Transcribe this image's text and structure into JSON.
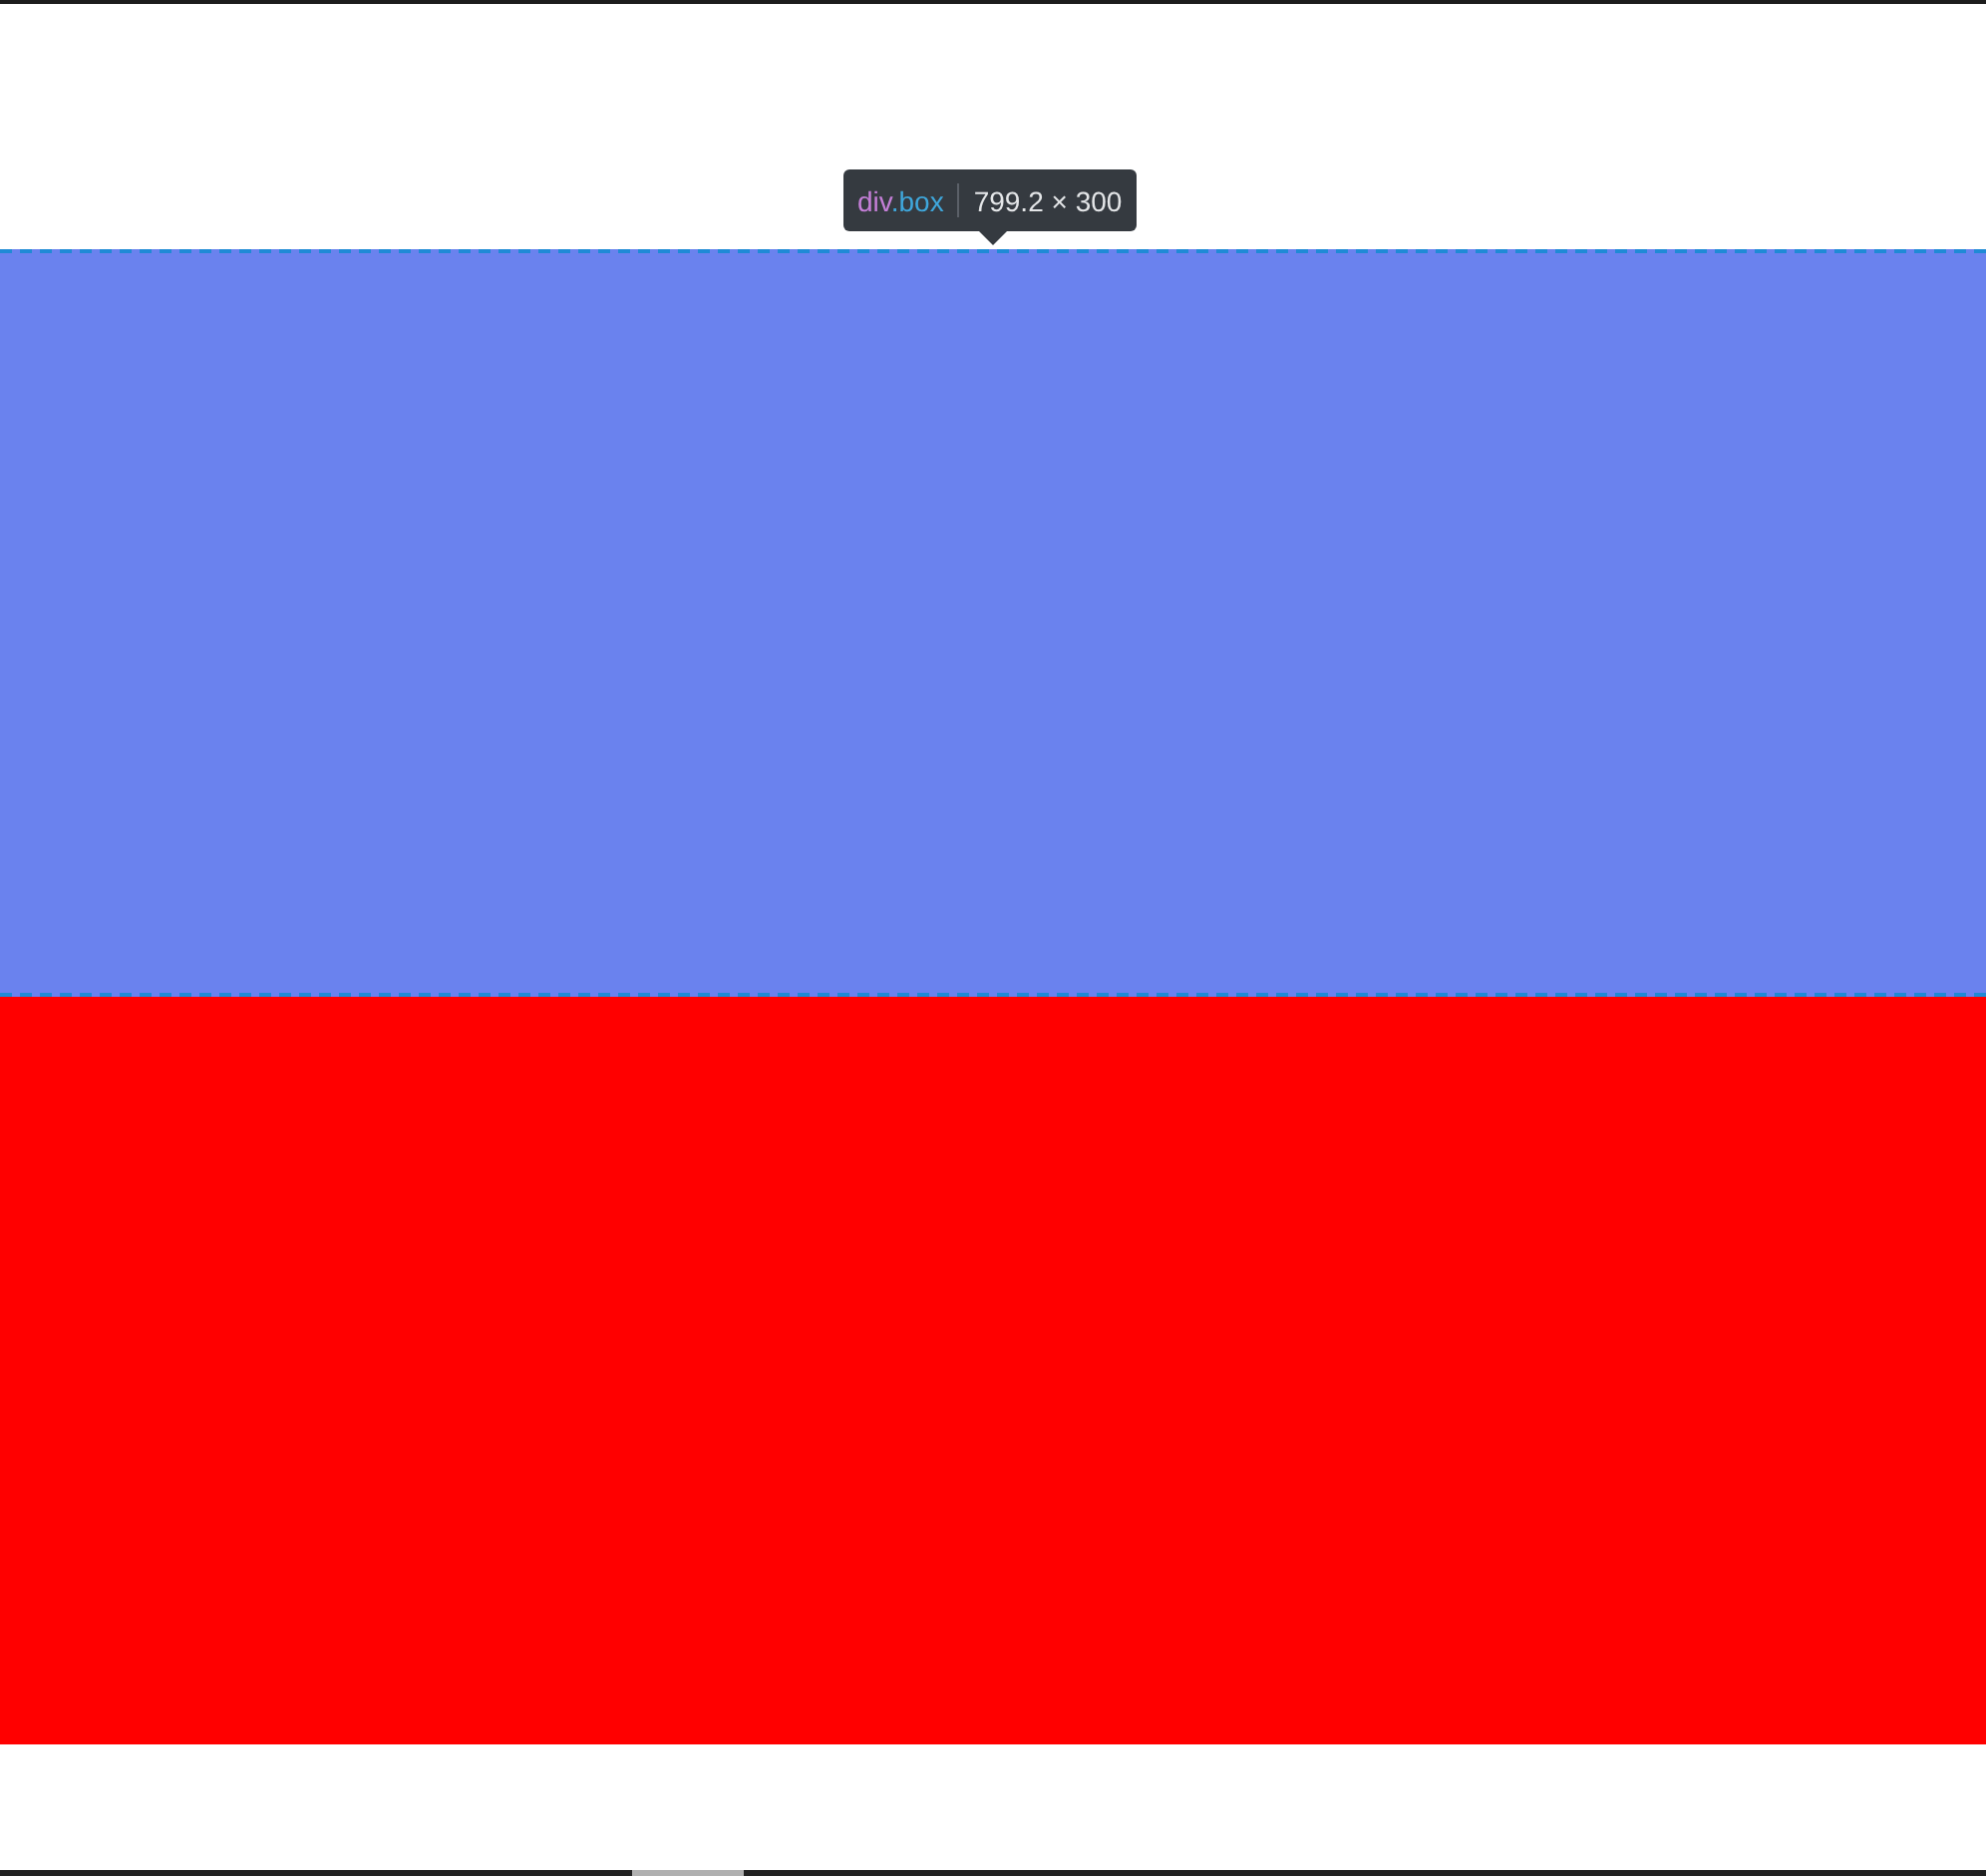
{
  "tooltip": {
    "tag": "div",
    "class_name": ".box",
    "size": "799.2 × 300"
  },
  "boxes": [
    {
      "color": "#6a82ee",
      "highlighted": true
    },
    {
      "color": "#ff0000",
      "highlighted": false
    }
  ]
}
